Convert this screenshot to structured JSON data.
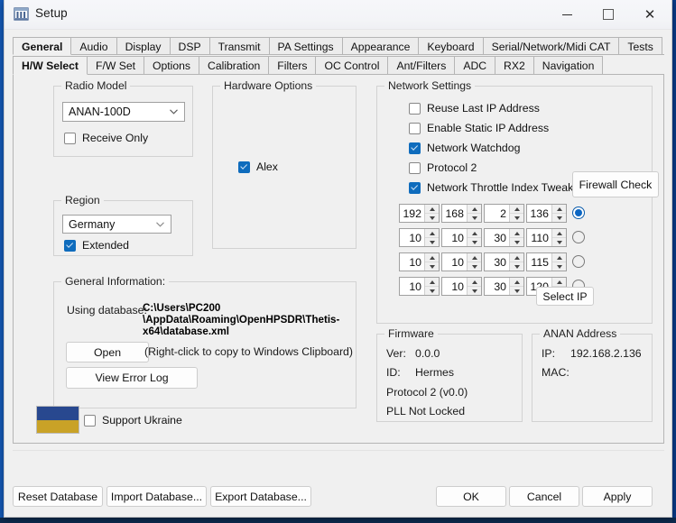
{
  "window": {
    "title": "Setup",
    "icon": "setup-window-icon",
    "controls": {
      "minimize": "–",
      "maximize": "□",
      "close": "✕"
    }
  },
  "tabs_primary": [
    {
      "label": "General",
      "selected": true
    },
    {
      "label": "Audio",
      "selected": false
    },
    {
      "label": "Display",
      "selected": false
    },
    {
      "label": "DSP",
      "selected": false
    },
    {
      "label": "Transmit",
      "selected": false
    },
    {
      "label": "PA Settings",
      "selected": false
    },
    {
      "label": "Appearance",
      "selected": false
    },
    {
      "label": "Keyboard",
      "selected": false
    },
    {
      "label": "Serial/Network/Midi CAT",
      "selected": false
    },
    {
      "label": "Tests",
      "selected": false
    }
  ],
  "tabs_secondary": [
    {
      "label": "H/W Select",
      "selected": true
    },
    {
      "label": "F/W Set",
      "selected": false
    },
    {
      "label": "Options",
      "selected": false
    },
    {
      "label": "Calibration",
      "selected": false
    },
    {
      "label": "Filters",
      "selected": false
    },
    {
      "label": "OC Control",
      "selected": false
    },
    {
      "label": "Ant/Filters",
      "selected": false
    },
    {
      "label": "ADC",
      "selected": false
    },
    {
      "label": "RX2",
      "selected": false
    },
    {
      "label": "Navigation",
      "selected": false
    }
  ],
  "radio_model": {
    "title": "Radio Model",
    "value": "ANAN-100D",
    "receive_only": {
      "label": "Receive Only",
      "checked": false
    }
  },
  "region": {
    "title": "Region",
    "value": "Germany",
    "extended": {
      "label": "Extended",
      "checked": true
    }
  },
  "hardware_options": {
    "title": "Hardware Options",
    "alex": {
      "label": "Alex",
      "checked": true
    }
  },
  "network_settings": {
    "title": "Network Settings",
    "checkboxes": [
      {
        "label": "Reuse Last IP Address",
        "checked": false
      },
      {
        "label": "Enable Static IP Address",
        "checked": false
      },
      {
        "label": "Network Watchdog",
        "checked": true
      },
      {
        "label": "Protocol 2",
        "checked": false
      },
      {
        "label": "Network Throttle Index Tweak",
        "checked": true
      }
    ],
    "firewall_check_label": "Firewall Check",
    "select_ip_label": "Select IP",
    "ip_rows": [
      {
        "octets": [
          "192",
          "168",
          "2",
          "136"
        ],
        "selected": true
      },
      {
        "octets": [
          "10",
          "10",
          "30",
          "110"
        ],
        "selected": false
      },
      {
        "octets": [
          "10",
          "10",
          "30",
          "115"
        ],
        "selected": false
      },
      {
        "octets": [
          "10",
          "10",
          "30",
          "120"
        ],
        "selected": false
      }
    ]
  },
  "general_information": {
    "title": "General Information:",
    "using_database_label": "Using database:",
    "database_path_line1": "C:\\Users\\PC200",
    "database_path_line2": "\\AppData\\Roaming\\OpenHPSDR\\Thetis-",
    "database_path_line3": "x64\\database.xml",
    "open_label": "Open",
    "view_error_log_label": "View Error Log",
    "hint": "(Right-click to copy to Windows Clipboard)"
  },
  "firmware": {
    "title": "Firmware",
    "ver_label": "Ver:",
    "ver_value": "0.0.0",
    "id_label": "ID:",
    "id_value": "Hermes",
    "protocol": "Protocol 2 (v0.0)",
    "pll": "PLL Not Locked"
  },
  "anan_address": {
    "title": "ANAN Address",
    "ip_label": "IP:",
    "ip_value": "192.168.2.136",
    "mac_label": "MAC:",
    "mac_value": ""
  },
  "support_ukraine": {
    "label": "Support Ukraine",
    "checked": false,
    "flag_top_color": "#28488f",
    "flag_bottom_color": "#c9a227"
  },
  "footer": {
    "reset_database": "Reset Database",
    "import_database": "Import Database...",
    "export_database": "Export Database...",
    "ok": "OK",
    "cancel": "Cancel",
    "apply": "Apply"
  },
  "colors": {
    "accent": "#0f6cbd",
    "radio_accent": "#0b66c3",
    "window_bg": "#f0f0f0"
  }
}
